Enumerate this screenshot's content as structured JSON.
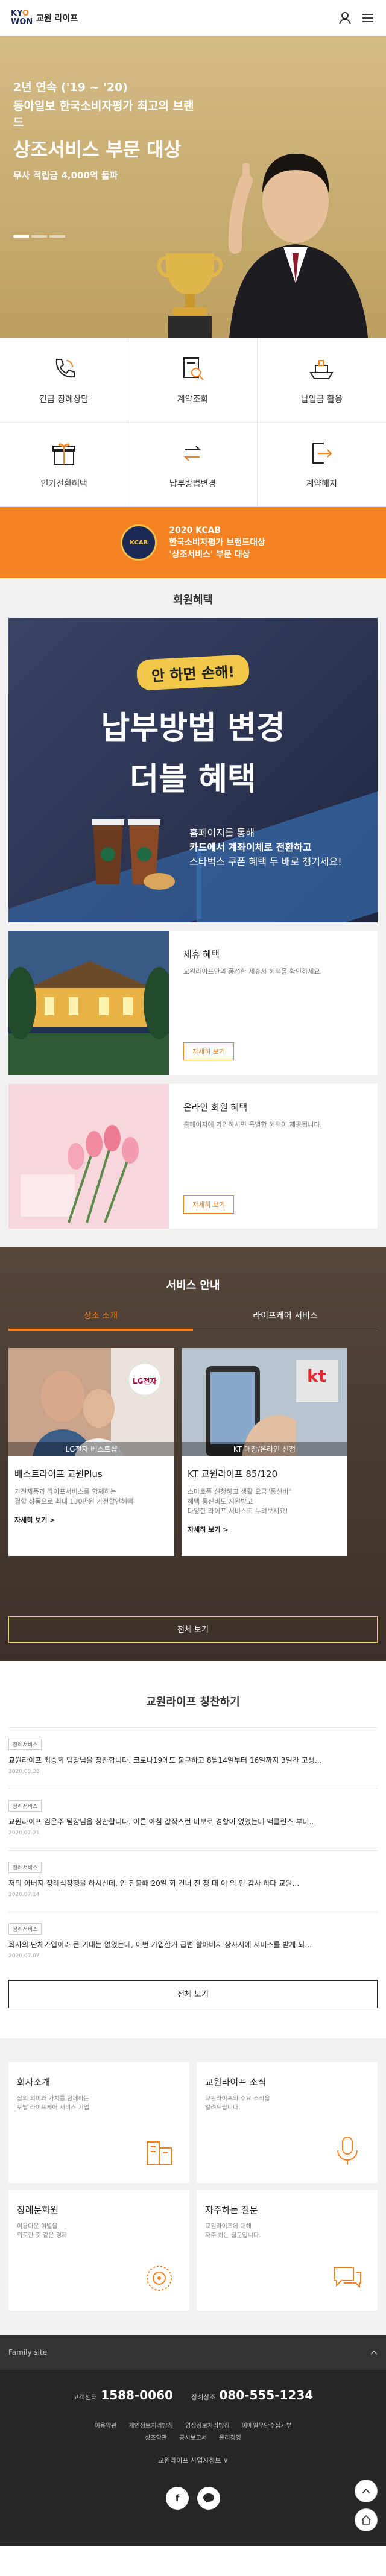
{
  "header": {
    "logo_mark_1": "KY",
    "logo_mark_o": "O",
    "logo_mark_2": "WON",
    "logo_text": "교원 라이프",
    "icons": [
      "user-icon",
      "menu-icon"
    ]
  },
  "hero": {
    "line1": "2년 연속 ('19 ~ '20)",
    "line2": "동아일보 한국소비자평가 최고의 브랜드",
    "line3": "상조서비스 부문 대상",
    "line4": "무사 적립금 4,000억 돌파",
    "line5": "",
    "slide_count": 3
  },
  "quick_menu": [
    {
      "label": "긴급 장례상담",
      "icon": "phone-icon"
    },
    {
      "label": "계약조회",
      "icon": "document-search-icon"
    },
    {
      "label": "납입금 활용",
      "icon": "ship-icon"
    },
    {
      "label": "인기전환혜택",
      "icon": "gift-icon"
    },
    {
      "label": "납부방법변경",
      "icon": "exchange-icon"
    },
    {
      "label": "계약해지",
      "icon": "exit-icon"
    }
  ],
  "award": {
    "badge": "KCAB",
    "line1": "2020 KCAB",
    "line2": "한국소비자평가 브랜드대상",
    "line3": "'상조서비스' 부문 대상"
  },
  "benefits": {
    "title": "회원혜택",
    "promo": {
      "pill": "안 하면 손해!",
      "title1": "납부방법 변경",
      "title2": "더블 혜택",
      "copy1": "홈페이지를 통해",
      "copy2": "카드에서 계좌이체로 전환하고",
      "copy3": "스타벅스 쿠폰 혜택 두 배로 챙기세요!"
    },
    "cards": [
      {
        "title": "제휴 혜택",
        "desc": "교원라이프만의 풍성한 제휴사 혜택을 확인하세요.",
        "button": "자세히 보기"
      },
      {
        "title": "온라인 회원 혜택",
        "desc": "홈페이지에 가입하시면 특별한 혜택이 제공됩니다.",
        "button": "자세히 보기"
      }
    ]
  },
  "services": {
    "title": "서비스 안내",
    "tabs": [
      "상조 소개",
      "라이프케어 서비스"
    ],
    "cards": [
      {
        "caption": "LG전자 베스트샵",
        "logo": "LG전자",
        "title": "베스트라이프 교원Plus",
        "desc1": "가전제품과 라이프서비스를 함께하는",
        "desc2": "결합 상품으로 최대 130만원 가전할인혜택",
        "desc3": "",
        "more": "자세히 보기 >"
      },
      {
        "caption": "KT 매장/온라인 신청",
        "logo": "kt",
        "title": "KT 교원라이프 85/120",
        "desc1": "스마트폰 신청하고 생활 요금\"통신비\"",
        "desc2": "혜택 통신비도 지원받고",
        "desc3": "다양한 라이프 서비스도 누려보세요!",
        "more": "자세히 보기 >"
      }
    ],
    "all_button": "전체 보기"
  },
  "praise": {
    "title": "교원라이프 칭찬하기",
    "items": [
      {
        "tag": "장례서비스",
        "text": "교원라이프 최승희 팀장님을 칭찬합니다. 코로나19에도 불구하고 8월14일부터 16일까지 3일간 고생…",
        "date": "2020.08.28"
      },
      {
        "tag": "장례서비스",
        "text": "교원라이프 김은주 팀장님을 칭찬합니다. 이른 아침 갑작스런 비보로 경황이 없었는데 맥클린스 부터…",
        "date": "2020.07.21"
      },
      {
        "tag": "장례서비스",
        "text": "저의 아버지 장례식장행을 하시신데, 인 진불때 20일 회 건너 진 청 대 이 의 인 감사 하다 교원…",
        "date": "2020.07.14"
      },
      {
        "tag": "장례서비스",
        "text": "회사의 단체가입이라 큰 기대는 없었는데, 이번 가입한거 급변 할아버지 상사시에 서비스를 받게 되…",
        "date": "2020.07.07"
      }
    ],
    "all_button": "전체 보기"
  },
  "info": [
    {
      "title": "회사소개",
      "desc1": "삶의 의미와 가치를 함께하는",
      "desc2": "토탈 라이프케어 서비스 기업",
      "icon": "building-icon"
    },
    {
      "title": "교원라이프 소식",
      "desc1": "교원라이프의 주요 소식을",
      "desc2": "알려드립니다.",
      "icon": "microphone-icon"
    },
    {
      "title": "장례문화원",
      "desc1": "이용다운 이별을",
      "desc2": "위로한 것 같은 경제",
      "icon": "lotus-icon"
    },
    {
      "title": "자주하는 질문",
      "desc1": "교원라이프에 대해",
      "desc2": "자주 하는 질문입니다.",
      "icon": "chat-icon"
    }
  ],
  "footer": {
    "family_label": "Family site",
    "phone1_label": "고객센터",
    "phone1": "1588-0060",
    "phone2_label": "장례상조",
    "phone2": "080-555-1234",
    "links": [
      "이용약관",
      "개인정보처리방침",
      "영상정보처리방침",
      "이메일무단수집거부",
      "상조약관",
      "공시보고서",
      "윤리경영"
    ],
    "affiliates": "교원라이프 사업자정보 ∨",
    "sns": [
      "f",
      "talk"
    ]
  },
  "colors": {
    "accent": "#f58220",
    "navy": "#1b2a55",
    "hero_bg": "#c7ad72"
  }
}
